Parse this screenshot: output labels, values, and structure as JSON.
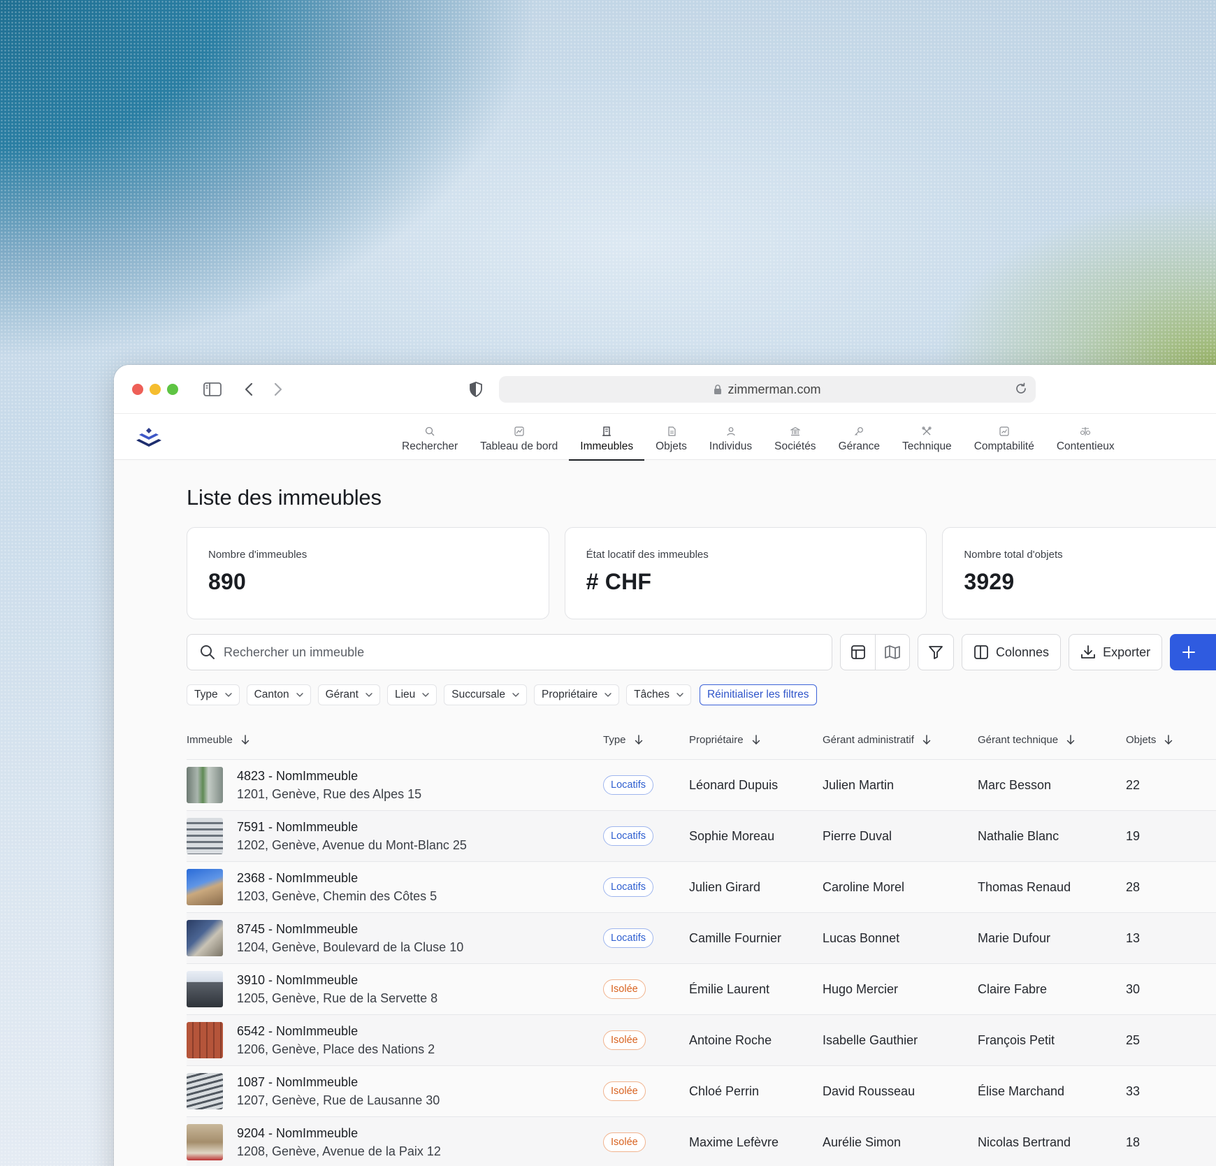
{
  "browser": {
    "url": "zimmerman.com"
  },
  "nav": {
    "items": [
      {
        "label": "Rechercher",
        "icon": "search-icon"
      },
      {
        "label": "Tableau de bord",
        "icon": "dashboard-icon"
      },
      {
        "label": "Immeubles",
        "icon": "building-icon",
        "active": true
      },
      {
        "label": "Objets",
        "icon": "document-icon"
      },
      {
        "label": "Individus",
        "icon": "person-icon"
      },
      {
        "label": "Sociétés",
        "icon": "bank-icon"
      },
      {
        "label": "Gérance",
        "icon": "key-icon"
      },
      {
        "label": "Technique",
        "icon": "tools-icon"
      },
      {
        "label": "Comptabilité",
        "icon": "ledger-icon"
      },
      {
        "label": "Contentieux",
        "icon": "scales-icon"
      }
    ]
  },
  "page": {
    "title": "Liste des immeubles"
  },
  "stats": [
    {
      "label": "Nombre d'immeubles",
      "value": "890"
    },
    {
      "label": "État locatif des immeubles",
      "value": "# CHF"
    },
    {
      "label": "Nombre total d'objets",
      "value": "3929"
    }
  ],
  "toolbar": {
    "search_placeholder": "Rechercher un immeuble",
    "columns_label": "Colonnes",
    "export_label": "Exporter"
  },
  "filters": {
    "chips": [
      "Type",
      "Canton",
      "Gérant",
      "Lieu",
      "Succursale",
      "Propriétaire",
      "Tâches"
    ],
    "reset_label": "Réinitialiser les filtres"
  },
  "table": {
    "headers": [
      "Immeuble",
      "Type",
      "Propriétaire",
      "Gérant administratif",
      "Gérant technique",
      "Objets"
    ],
    "rows": [
      {
        "name": "4823 - NomImmeuble",
        "address": "1201, Genève, Rue des Alpes 15",
        "type": "Locatifs",
        "owner": "Léonard Dupuis",
        "admin": "Julien Martin",
        "tech": "Marc Besson",
        "objects": "22"
      },
      {
        "name": "7591 - NomImmeuble",
        "address": "1202, Genève, Avenue du Mont-Blanc 25",
        "type": "Locatifs",
        "owner": "Sophie Moreau",
        "admin": "Pierre Duval",
        "tech": "Nathalie Blanc",
        "objects": "19"
      },
      {
        "name": "2368 - NomImmeuble",
        "address": "1203, Genève, Chemin des Côtes 5",
        "type": "Locatifs",
        "owner": "Julien Girard",
        "admin": "Caroline Morel",
        "tech": "Thomas Renaud",
        "objects": "28"
      },
      {
        "name": "8745 - NomImmeuble",
        "address": "1204, Genève, Boulevard de la Cluse 10",
        "type": "Locatifs",
        "owner": "Camille Fournier",
        "admin": "Lucas Bonnet",
        "tech": "Marie Dufour",
        "objects": "13"
      },
      {
        "name": "3910 - NomImmeuble",
        "address": "1205, Genève, Rue de la Servette 8",
        "type": "Isolée",
        "owner": "Émilie Laurent",
        "admin": "Hugo Mercier",
        "tech": "Claire Fabre",
        "objects": "30"
      },
      {
        "name": "6542 - NomImmeuble",
        "address": "1206, Genève, Place des Nations 2",
        "type": "Isolée",
        "owner": "Antoine Roche",
        "admin": "Isabelle Gauthier",
        "tech": "François Petit",
        "objects": "25"
      },
      {
        "name": "1087 - NomImmeuble",
        "address": "1207, Genève, Rue de Lausanne 30",
        "type": "Isolée",
        "owner": "Chloé Perrin",
        "admin": "David Rousseau",
        "tech": "Élise Marchand",
        "objects": "33"
      },
      {
        "name": "9204 - NomImmeuble",
        "address": "1208, Genève, Avenue de la Paix 12",
        "type": "Isolée",
        "owner": "Maxime Lefèvre",
        "admin": "Aurélie Simon",
        "tech": "Nicolas Bertrand",
        "objects": "18"
      }
    ]
  },
  "colors": {
    "accent": "#2f5be0",
    "locatifs": "#2f5fd0",
    "isolee": "#d8621f"
  }
}
